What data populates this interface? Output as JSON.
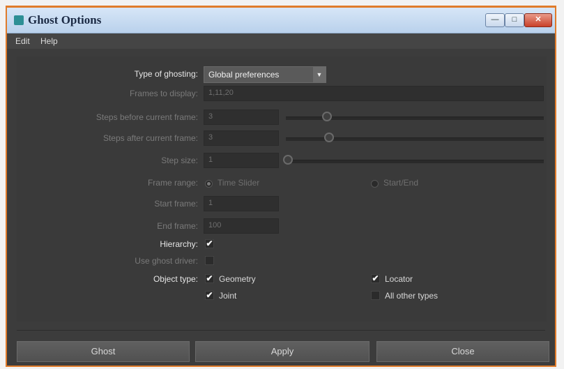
{
  "window": {
    "title": "Ghost Options",
    "icon": "maya-icon",
    "accent": "#e07b2a"
  },
  "titlebar_buttons": {
    "minimize": "—",
    "maximize": "□",
    "close": "✕"
  },
  "menubar": {
    "items": [
      "Edit",
      "Help"
    ]
  },
  "form": {
    "type_of_ghosting": {
      "label": "Type of ghosting:",
      "value": "Global preferences"
    },
    "frames_to_display": {
      "label": "Frames to display:",
      "value": "1,11,20"
    },
    "steps_before": {
      "label": "Steps before current frame:",
      "value": "3",
      "slider_fraction": 0.15
    },
    "steps_after": {
      "label": "Steps after current frame:",
      "value": "3",
      "slider_fraction": 0.16
    },
    "step_size": {
      "label": "Step size:",
      "value": "1",
      "slider_fraction": 0.0
    },
    "frame_range": {
      "label": "Frame range:",
      "option_a": "Time Slider",
      "option_b": "Start/End",
      "selected": "Time Slider"
    },
    "start_frame": {
      "label": "Start frame:",
      "value": "1"
    },
    "end_frame": {
      "label": "End frame:",
      "value": "100"
    },
    "hierarchy": {
      "label": "Hierarchy:",
      "checked": true
    },
    "use_ghost_driver": {
      "label": "Use ghost driver:",
      "checked": false
    },
    "object_type": {
      "label": "Object type:",
      "geometry": {
        "label": "Geometry",
        "checked": true
      },
      "locator": {
        "label": "Locator",
        "checked": true
      },
      "joint": {
        "label": "Joint",
        "checked": true
      },
      "all_other": {
        "label": "All other types",
        "checked": false
      }
    }
  },
  "buttons": {
    "ghost": "Ghost",
    "apply": "Apply",
    "close": "Close"
  },
  "check_glyph": "✔"
}
